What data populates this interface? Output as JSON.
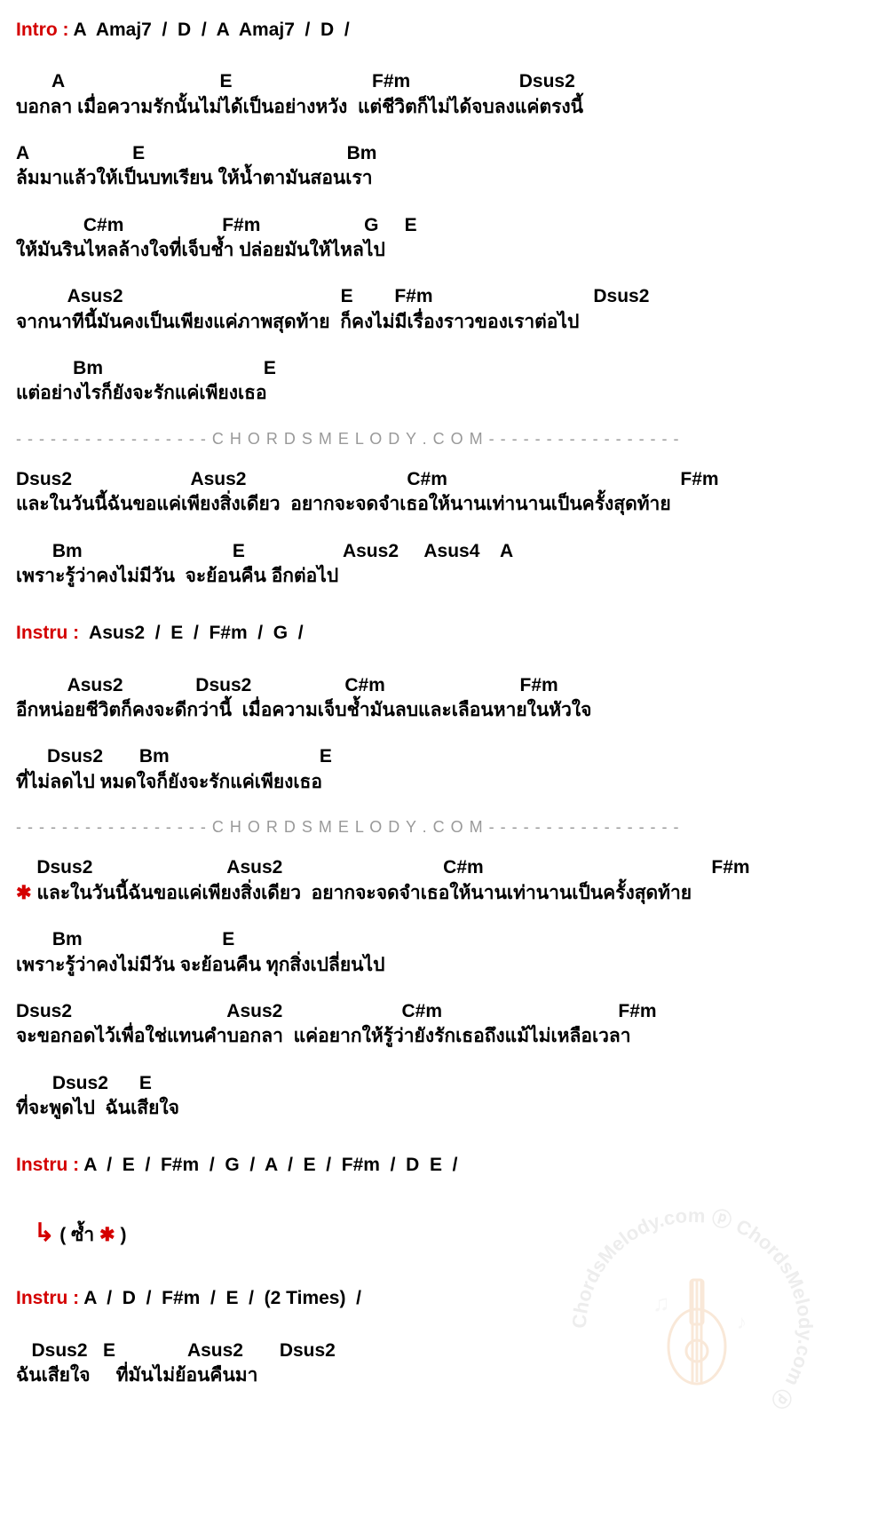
{
  "intro": {
    "label": "Intro :",
    "chords": " A  Amaj7  /  D  /  A  Amaj7  /  D  /"
  },
  "verse1": [
    {
      "chords": "       A                              E                           F#m                     Dsus2",
      "lyric": "บอกลา เมื่อความรักนั้นไม่ได้เป็นอย่างหวัง  แต่ชีวิตก็ไม่ได้จบลงแค่ตรงนี้"
    },
    {
      "chords": "A                    E                                       Bm",
      "lyric": "ล้มมาแล้วให้เป็นบทเรียน ให้น้ำตามันสอนเรา"
    },
    {
      "chords": "             C#m                   F#m                    G     E",
      "lyric": "ให้มันรินไหลล้างใจที่เจ็บช้ำ ปล่อยมันให้ไหลไป"
    },
    {
      "chords": "          Asus2                                          E        F#m                               Dsus2",
      "lyric": "จากนาทีนี้มันคงเป็นเพียงแค่ภาพสุดท้าย  ก็คงไม่มีเรื่องราวของเราต่อไป"
    },
    {
      "chords": "           Bm                               E",
      "lyric": "แต่อย่างไรก็ยังจะรักแค่เพียงเธอ"
    }
  ],
  "divider1": "-  -  -  -  -  -  -  -  -  -  -  -  -  -  -  -  -    C H O R D S M E L O D Y . C O M    -  -  -  -  -  -  -  -  -  -  -  -  -  -  -  -  -",
  "chorus1": [
    {
      "chords": "Dsus2                       Asus2                               C#m                                             F#m",
      "lyric": "และในวันนี้ฉันขอแค่เพียงสิ่งเดียว  อยากจะจดจำเธอให้นานเท่านานเป็นครั้งสุดท้าย"
    },
    {
      "chords": "       Bm                             E                   Asus2     Asus4    A",
      "lyric": "เพราะรู้ว่าคงไม่มีวัน  จะย้อนคืน อีกต่อไป"
    }
  ],
  "instru1": {
    "label": "Instru :",
    "chords": "  Asus2  /  E  /  F#m  /  G  /"
  },
  "verse2": [
    {
      "chords": "          Asus2              Dsus2                  C#m                          F#m",
      "lyric": "อีกหน่อยชีวิตก็คงจะดีกว่านี้  เมื่อความเจ็บช้ำมันลบและเลือนหายในหัวใจ"
    },
    {
      "chords": "      Dsus2       Bm                             E",
      "lyric": "ที่ไม่ลดไป หมดใจก็ยังจะรักแค่เพียงเธอ"
    }
  ],
  "divider2": "-  -  -  -  -  -  -  -  -  -  -  -  -  -  -  -  -    C H O R D S M E L O D Y . C O M    -  -  -  -  -  -  -  -  -  -  -  -  -  -  -  -  -",
  "chorus2": [
    {
      "chords": "    Dsus2                          Asus2                               C#m                                            F#m",
      "prefix": "✱",
      "lyric": " และในวันนี้ฉันขอแค่เพียงสิ่งเดียว  อยากจะจดจำเธอให้นานเท่านานเป็นครั้งสุดท้าย"
    },
    {
      "chords": "       Bm                           E",
      "lyric": "เพราะรู้ว่าคงไม่มีวัน จะย้อนคืน ทุกสิ่งเปลี่ยนไป"
    },
    {
      "chords": "Dsus2                              Asus2                       C#m                                  F#m",
      "lyric": "จะขอกอดไว้เพื่อใช่แทนคำบอกลา  แค่อยากให้รู้ว่ายังรักเธอถึงแม้ไม่เหลือเวลา"
    },
    {
      "chords": "       Dsus2      E",
      "lyric": "ที่จะพูดไป  ฉันเสียใจ"
    }
  ],
  "instru2": {
    "label": "Instru :",
    "chords": " A  /  E  /  F#m  /  G  /  A  /  E  /  F#m  /  D  E  /"
  },
  "repeat": {
    "arrow": "↳",
    "text": " ( ซ้ำ ",
    "star": "✱",
    "close": " )"
  },
  "instru3": {
    "label": "Instru :",
    "chords": " A  /  D  /  F#m  /  E  /  (2 Times)  /"
  },
  "outro": [
    {
      "chords": "   Dsus2   E              Asus2       Dsus2",
      "lyric": "ฉันเสียใจ     ที่มันไม่ย้อนคืนมา"
    }
  ]
}
